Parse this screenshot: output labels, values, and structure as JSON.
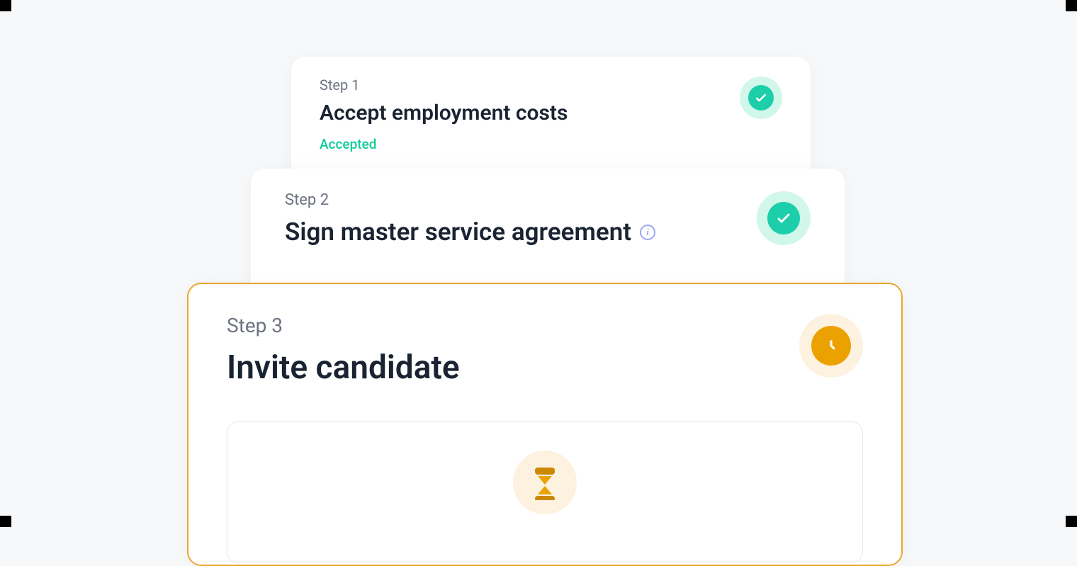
{
  "steps": [
    {
      "label": "Step 1",
      "title": "Accept employment costs",
      "status": "Accepted",
      "state": "complete"
    },
    {
      "label": "Step 2",
      "title": "Sign master service agreement",
      "state": "complete"
    },
    {
      "label": "Step 3",
      "title": "Invite candidate",
      "state": "pending"
    }
  ]
}
